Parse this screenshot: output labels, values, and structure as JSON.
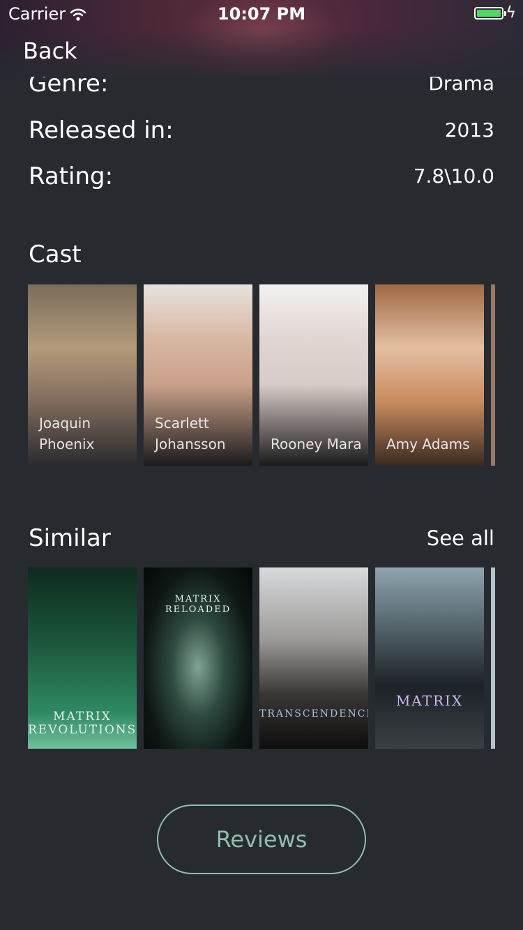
{
  "status_bar": {
    "carrier": "Carrier",
    "time": "10:07 PM"
  },
  "nav": {
    "back_label": "Back"
  },
  "details": {
    "genre_label": "Genre:",
    "genre_value": "Drama",
    "released_label": "Released in:",
    "released_value": "2013",
    "rating_label": "Rating:",
    "rating_value": "7.8\\10.0"
  },
  "cast": {
    "title": "Cast",
    "items": [
      {
        "name": "Joaquin Phoenix"
      },
      {
        "name": "Scarlett Johansson"
      },
      {
        "name": "Rooney Mara"
      },
      {
        "name": "Amy Adams"
      }
    ]
  },
  "similar": {
    "title": "Similar",
    "see_all_label": "See all",
    "items": [
      {
        "poster_text": "MATRIX REVOLUTIONS"
      },
      {
        "poster_text": "MATRIX RELOADED"
      },
      {
        "poster_text": "TRANSCENDENCE"
      },
      {
        "poster_text": "MATRIX"
      }
    ]
  },
  "reviews_label": "Reviews",
  "colors": {
    "background": "#272b30",
    "accent": "#8fbfae",
    "battery": "#4cd964"
  }
}
